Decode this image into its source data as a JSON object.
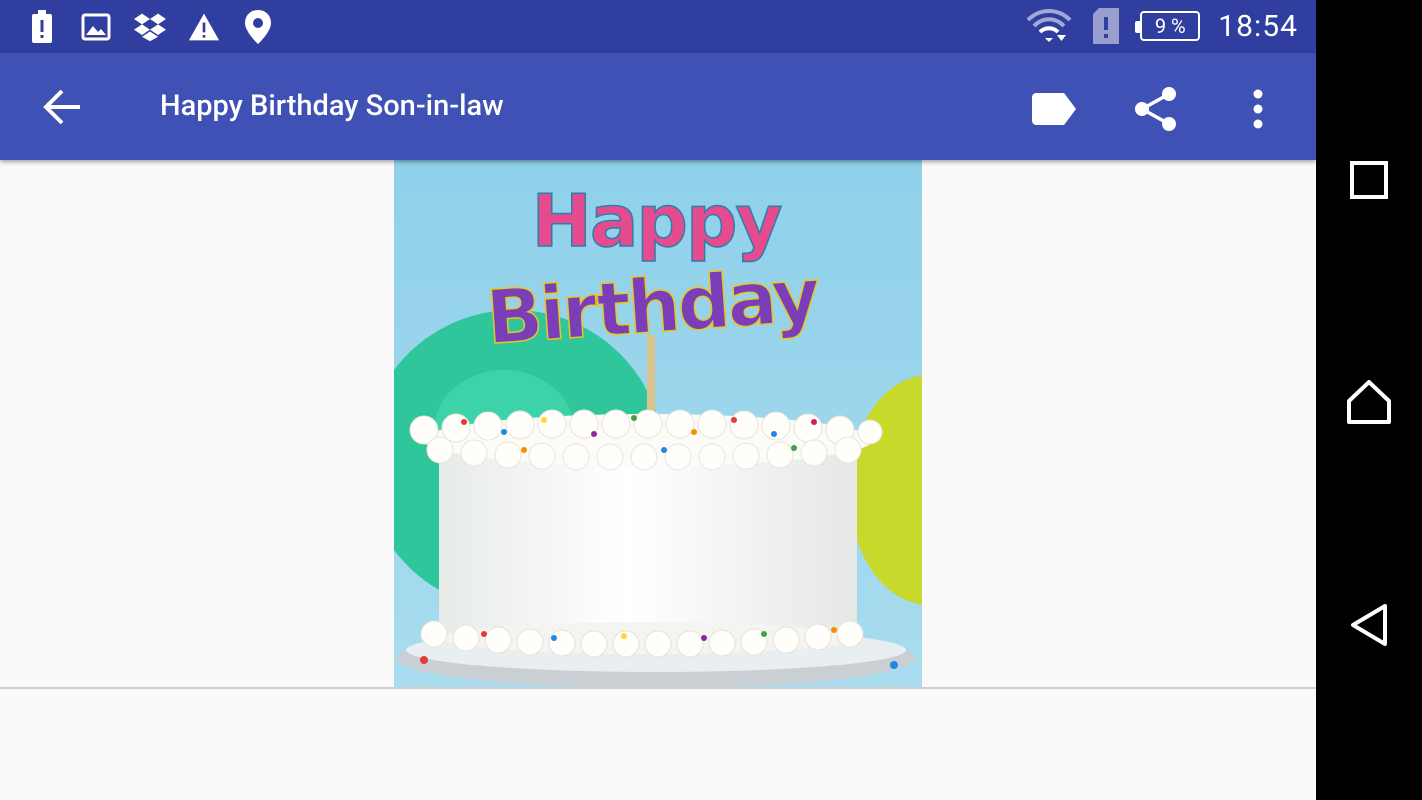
{
  "status_bar": {
    "left_icons": [
      "battery-alert-icon",
      "image-icon",
      "dropbox-icon",
      "warning-icon",
      "location-icon"
    ],
    "battery_level": "9 %",
    "time": "18:54"
  },
  "toolbar": {
    "title": "Happy Birthday Son-in-law",
    "actions": [
      "label-icon",
      "share-icon",
      "more-vert-icon"
    ]
  },
  "card": {
    "topper_line1": "Happy",
    "topper_line2": "Birthday",
    "image_description_icon": "birthday-cake-image"
  },
  "navigation_bar": {
    "buttons": [
      "recents-button",
      "home-button",
      "back-button"
    ]
  },
  "colors": {
    "status_bar": "#303f9f",
    "toolbar": "#3f51b5",
    "background": "#fafafa"
  }
}
